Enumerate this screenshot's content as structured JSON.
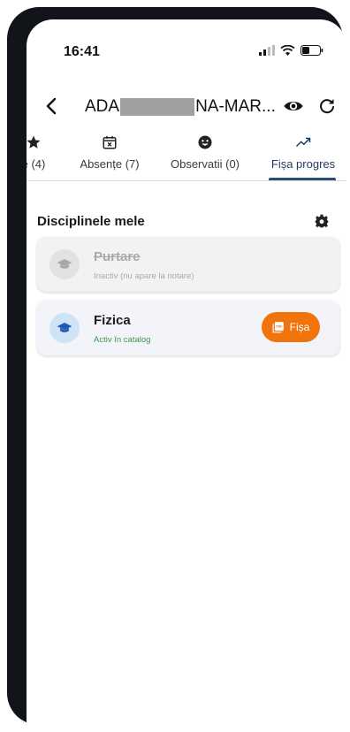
{
  "status_bar": {
    "time": "16:41"
  },
  "app_bar": {
    "title_prefix": "ADA",
    "title_suffix": "NA-MAR..."
  },
  "tabs": [
    {
      "label": "e (4)",
      "icon": "star-icon"
    },
    {
      "label": "Absențe (7)",
      "icon": "calendar-x-icon"
    },
    {
      "label": "Observatii (0)",
      "icon": "smiley-icon"
    },
    {
      "label": "Fișa progres",
      "icon": "trending-up-icon",
      "active": true
    }
  ],
  "section": {
    "title": "Disciplinele mele"
  },
  "subjects": [
    {
      "name": "Purtare",
      "status": "Inactiv (nu apare la notare)",
      "active": false
    },
    {
      "name": "Fizica",
      "status": "Activ în catalog",
      "active": true,
      "action_label": "Fișa"
    }
  ],
  "colors": {
    "accent_orange": "#f0730b",
    "tab_active": "#2d4b73",
    "active_green": "#3b9a4c",
    "avatar_blue": "#1e5bb0"
  }
}
